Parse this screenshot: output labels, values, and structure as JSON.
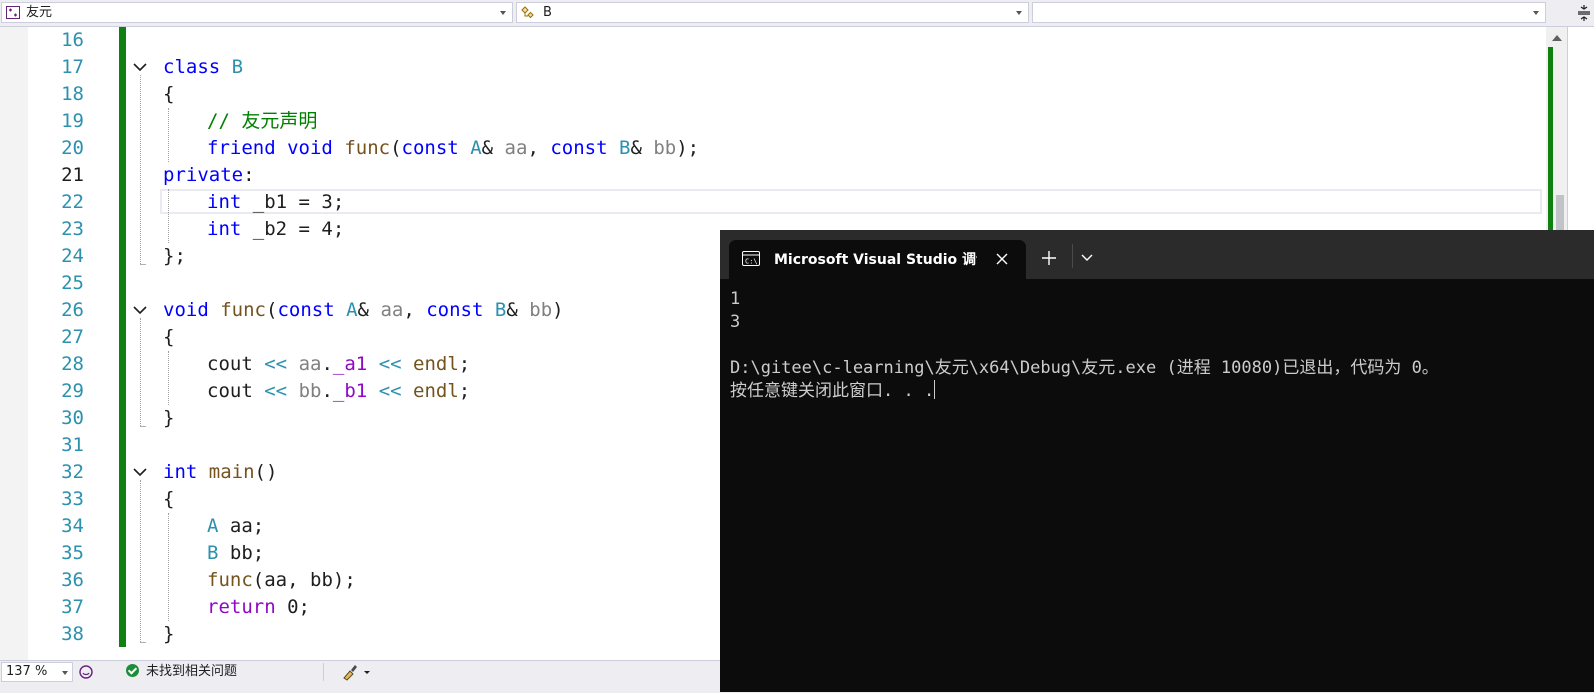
{
  "navbar": {
    "project": "友元",
    "scope": "B",
    "member": ""
  },
  "editor": {
    "lines": [
      {
        "n": "16"
      },
      {
        "n": "17"
      },
      {
        "n": "18"
      },
      {
        "n": "19"
      },
      {
        "n": "20"
      },
      {
        "n": "21"
      },
      {
        "n": "22"
      },
      {
        "n": "23"
      },
      {
        "n": "24"
      },
      {
        "n": "25"
      },
      {
        "n": "26"
      },
      {
        "n": "27"
      },
      {
        "n": "28"
      },
      {
        "n": "29"
      },
      {
        "n": "30"
      },
      {
        "n": "31"
      },
      {
        "n": "32"
      },
      {
        "n": "33"
      },
      {
        "n": "34"
      },
      {
        "n": "35"
      },
      {
        "n": "36"
      },
      {
        "n": "37"
      },
      {
        "n": "38"
      }
    ],
    "tokens": {
      "l17": [
        "class",
        " ",
        "B"
      ],
      "l18": [
        "{"
      ],
      "l19": [
        "// 友元声明"
      ],
      "l20": [
        "friend",
        " ",
        "void",
        " ",
        "func",
        "(",
        "const",
        " ",
        "A",
        "&",
        " ",
        "aa",
        ", ",
        "const",
        " ",
        "B",
        "&",
        " ",
        "bb",
        ");"
      ],
      "l21": [
        "private",
        ":"
      ],
      "l22": [
        "int",
        " _b1 = 3;"
      ],
      "l23": [
        "int",
        " _b2 = 4;"
      ],
      "l24": [
        "};"
      ],
      "l26": [
        "void",
        " ",
        "func",
        "(",
        "const",
        " ",
        "A",
        "&",
        " ",
        "aa",
        ", ",
        "const",
        " ",
        "B",
        "&",
        " ",
        "bb",
        ")"
      ],
      "l27": [
        "{"
      ],
      "l28": [
        "cout",
        " ",
        "<<",
        " ",
        "aa",
        ".",
        "_a1",
        " ",
        "<<",
        " ",
        "endl",
        ";"
      ],
      "l29": [
        "cout",
        " ",
        "<<",
        " ",
        "bb",
        ".",
        "_b1",
        " ",
        "<<",
        " ",
        "endl",
        ";"
      ],
      "l30": [
        "}"
      ],
      "l32": [
        "int",
        " ",
        "main",
        "()"
      ],
      "l33": [
        "{"
      ],
      "l34": [
        "A",
        " ",
        "aa",
        ";"
      ],
      "l35": [
        "B",
        " ",
        "bb",
        ";"
      ],
      "l36": [
        "func",
        "(",
        "aa",
        ", ",
        "bb",
        ");"
      ],
      "l37": [
        "return",
        " 0;"
      ],
      "l38": [
        "}"
      ]
    },
    "current_line": "21"
  },
  "status": {
    "zoom": "137 %",
    "issues": "未找到相关问题"
  },
  "console": {
    "tab_title": "Microsoft Visual Studio 调试控制台",
    "output": "1\n3\n\nD:\\gitee\\c-learning\\友元\\x64\\Debug\\友元.exe (进程 10080)已退出，代码为 0。\n按任意键关闭此窗口. . ."
  },
  "colors": {
    "keyword": "#0000ff",
    "type": "#2b91af",
    "function": "#74531f",
    "parameter": "#808080",
    "comment": "#008000",
    "member": "#8f08c4",
    "change_bar": "#108010",
    "console_bg": "#0c0c0c"
  }
}
